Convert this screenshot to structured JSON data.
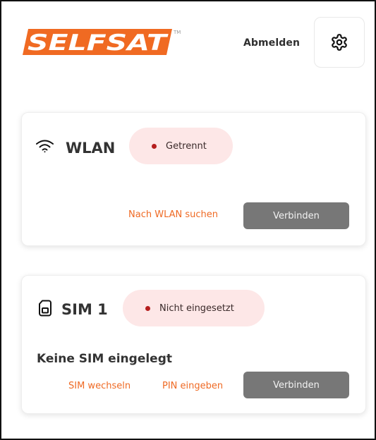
{
  "header": {
    "brand": "SELFSAT",
    "brand_tm": "TM",
    "brand_color": "#f06a22",
    "logout_label": "Abmelden",
    "settings_icon": "gear-icon"
  },
  "wifi_card": {
    "icon": "wifi-icon",
    "title": "WLAN",
    "status_text": "Getrennt",
    "status_color": "#b51e1e",
    "status_bg": "#fde7e7",
    "search_link": "Nach WLAN suchen",
    "connect_label": "Verbinden"
  },
  "sim_card": {
    "icon": "sim-card-icon",
    "title": "SIM 1",
    "status_text": "Nicht eingesetzt",
    "status_color": "#b51e1e",
    "status_bg": "#fde7e7",
    "message": "Keine SIM eingelegt",
    "switch_link": "SIM wechseln",
    "pin_link": "PIN eingeben",
    "connect_label": "Verbinden"
  },
  "colors": {
    "accent": "#ef6a24",
    "button_gray": "#777777",
    "card_border": "#eeeeee"
  }
}
